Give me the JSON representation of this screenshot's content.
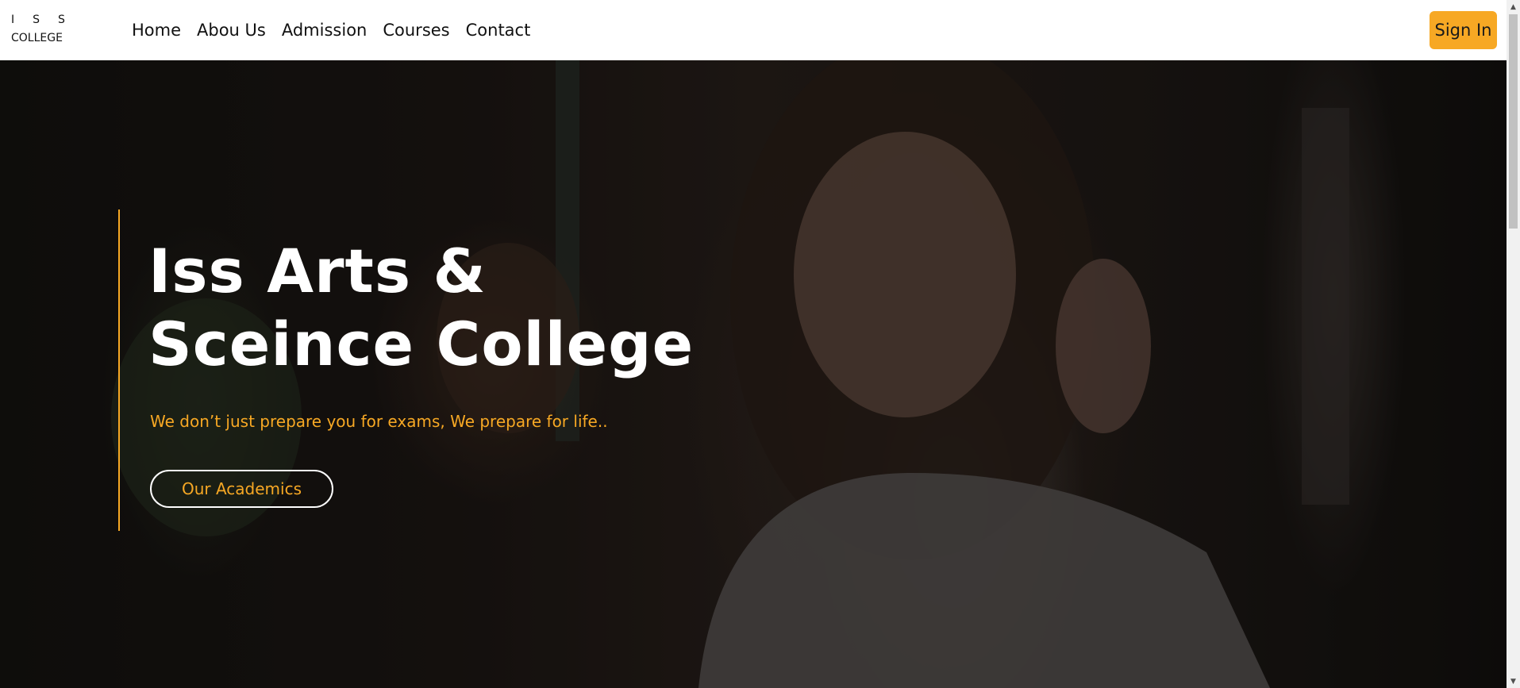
{
  "logo": {
    "letters": [
      "I",
      "S",
      "S"
    ],
    "subtitle": "COLLEGE"
  },
  "nav": {
    "items": [
      {
        "label": "Home"
      },
      {
        "label": "Abou Us"
      },
      {
        "label": "Admission"
      },
      {
        "label": "Courses"
      },
      {
        "label": "Contact"
      }
    ]
  },
  "header": {
    "signin_label": "Sign In",
    "accent_color": "#f7a824"
  },
  "hero": {
    "title": "Iss Arts & Sceince College",
    "subtitle": "We don’t just prepare you for exams, We prepare for life..",
    "button_label": "Our Academics"
  },
  "scrollbar": {
    "up_icon": "▲",
    "down_icon": "▼"
  }
}
